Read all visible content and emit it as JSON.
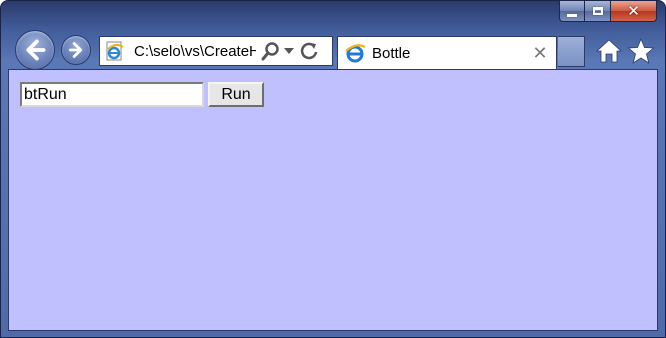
{
  "window": {
    "caption": {
      "minimize_icon": "minimize-icon",
      "maximize_icon": "maximize-icon",
      "close_icon": "close-icon"
    },
    "frame_color": "#3f5a97"
  },
  "navigation": {
    "back_icon": "back-arrow-icon",
    "forward_icon": "forward-arrow-icon"
  },
  "address_bar": {
    "url": "C:\\selo\\vs\\CreateH",
    "favicon": "ie-page-icon",
    "search_icon": "search-icon",
    "dropdown_icon": "chevron-down-icon",
    "refresh_icon": "refresh-icon"
  },
  "tab": {
    "title": "Bottle",
    "favicon": "ie-logo-icon",
    "close_glyph": "✕"
  },
  "toolbar": {
    "home_icon": "home-icon",
    "favorites_icon": "star-icon"
  },
  "page": {
    "background": "#c0c0ff",
    "input_value": "btRun",
    "run_button_label": "Run"
  }
}
